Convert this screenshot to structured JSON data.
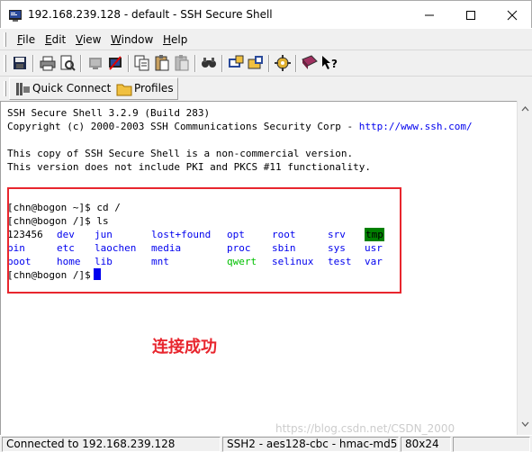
{
  "window": {
    "title": "192.168.239.128 - default - SSH Secure Shell",
    "app_icon": "ssh-terminal-icon",
    "controls": [
      "minimize-icon",
      "maximize-icon",
      "close-icon"
    ]
  },
  "menu": {
    "file": {
      "mn": "F",
      "rest": "ile"
    },
    "edit": {
      "mn": "E",
      "rest": "dit"
    },
    "view": {
      "mn": "V",
      "rest": "iew"
    },
    "window": {
      "mn": "W",
      "rest": "indow"
    },
    "help": {
      "mn": "H",
      "rest": "elp"
    }
  },
  "toolbar": {
    "icons": [
      "save-icon",
      "print-icon",
      "print-preview-icon",
      "disconnect-icon",
      "new-terminal-icon",
      "copy-icon",
      "paste-icon",
      "paste-disabled-icon",
      "find-icon",
      "profiles-icon",
      "settings-icon",
      "key-icon",
      "book-icon",
      "help-icon"
    ]
  },
  "quickbar": {
    "quick_connect": "Quick Connect",
    "profiles": "Profiles"
  },
  "terminal": {
    "banner1": "SSH Secure Shell 3.2.9 (Build 283)",
    "banner2": "Copyright (c) 2000-2003 SSH Communications Security Corp - ",
    "banner2_url": "http://www.ssh.com/",
    "notice1": "This copy of SSH Secure Shell is a non-commercial version.",
    "notice2": "This version does not include PKI and PKCS #11 functionality.",
    "cmd1": "[chn@bogon ~]$ cd /",
    "cmd2": "[chn@bogon /]$ ls",
    "ls_rows": [
      [
        "123456",
        "dev",
        "jun",
        "lost+found",
        "opt",
        "root",
        "srv",
        "tmp"
      ],
      [
        "bin",
        "etc",
        "laochen",
        "media",
        "proc",
        "sbin",
        "sys",
        "usr"
      ],
      [
        "boot",
        "home",
        "lib",
        "mnt",
        "qwert",
        "selinux",
        "test",
        "var"
      ]
    ],
    "prompt": "[chn@bogon /]$",
    "colors": {
      "dir": "#0000ee",
      "exec": "#00c000",
      "plain": "#000000",
      "sticky_bg": "#008000",
      "highlight_box": "#e8262e"
    }
  },
  "annotation": "连接成功",
  "watermark": "https://blog.csdn.net/CSDN_2000",
  "status": {
    "connection": "Connected to 192.168.239.128",
    "cipher": "SSH2 - aes128-cbc - hmac-md5",
    "size": "80x24"
  }
}
